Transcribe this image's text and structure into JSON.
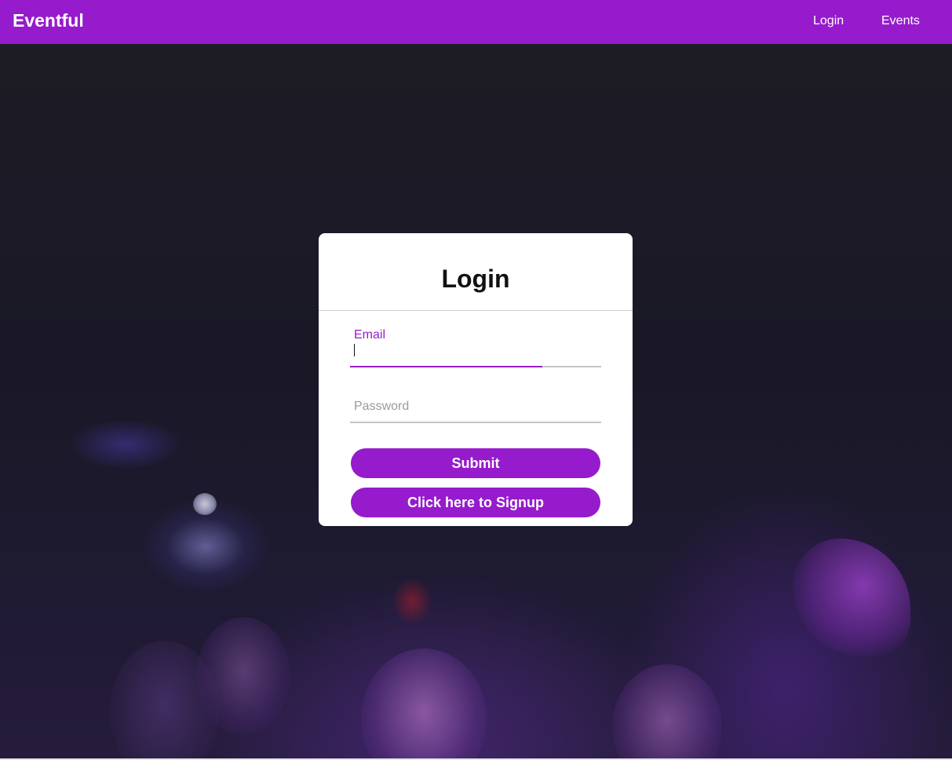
{
  "navbar": {
    "brand": "Eventful",
    "links": [
      {
        "label": "Login"
      },
      {
        "label": "Events"
      }
    ],
    "color": "#961bcc"
  },
  "login_card": {
    "title": "Login",
    "email": {
      "label": "Email",
      "value": ""
    },
    "password": {
      "placeholder": "Password",
      "value": ""
    },
    "submit_label": "Submit",
    "signup_label": "Click here to Signup",
    "accent_color": "#961bcc"
  }
}
